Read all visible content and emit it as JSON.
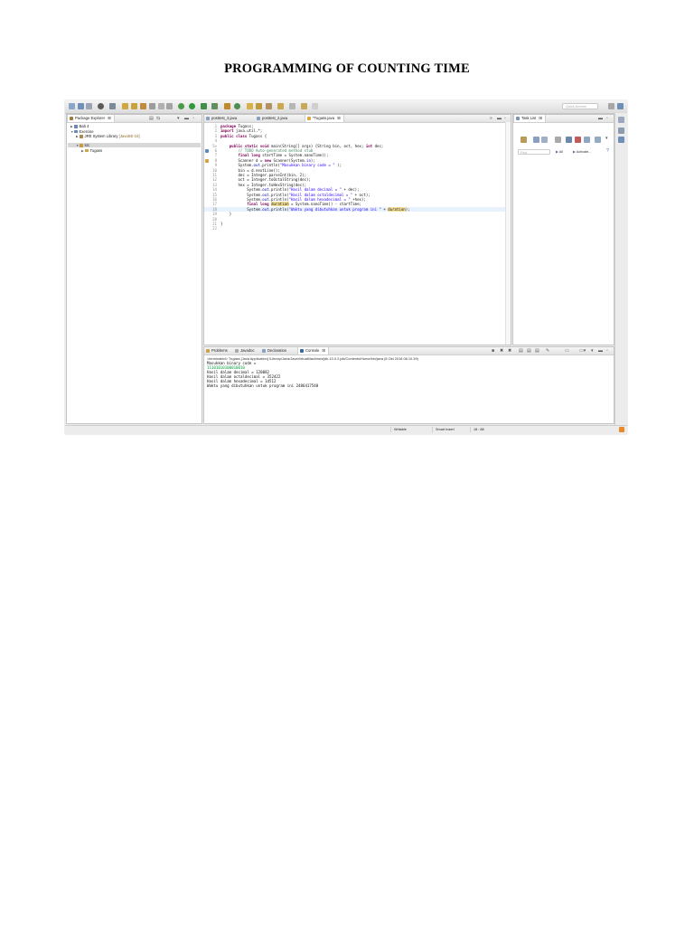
{
  "document": {
    "title": "PROGRAMMING OF COUNTING TIME"
  },
  "toolbar": {
    "quick_access_placeholder": "Quick Access"
  },
  "package_explorer": {
    "title": "Package Explorer",
    "close_glyph": "☒",
    "items": [
      {
        "label": "Bab 4",
        "suffix": ""
      },
      {
        "label": "Exercise",
        "suffix": ""
      },
      {
        "label": "JRE System Library",
        "suffix": "[JavaSE-10]"
      },
      {
        "label": "src",
        "suffix": ""
      },
      {
        "label": "Tugass",
        "suffix": ""
      }
    ]
  },
  "editor": {
    "tabs": [
      {
        "label": "posttest_3.java"
      },
      {
        "label": "posttest_2.java"
      },
      {
        "label": "*Tugass.java"
      }
    ],
    "line_numbers": [
      "1",
      "2",
      "3",
      "4",
      "5⊖",
      "6",
      "7",
      "8",
      "9",
      "10",
      "11",
      "12",
      "13",
      "14",
      "15",
      "16",
      "17",
      "18",
      "19",
      "20",
      "21",
      "22"
    ],
    "lines": [
      "package Tugass;",
      "import java.util.*;",
      "public class Tugass {",
      "",
      "    public static void main(String[] args) {String bin, oct, hex; int dec;",
      "        // TODO Auto-generated method stub",
      "        final long startTime = System.nanoTime();",
      "        Scanner d = new Scanner(System.in);",
      "        System.out.println(\"Masukkan binary code = \" );",
      "        bin = d.nextLine();",
      "        dec = Integer.parseInt(bin, 2);",
      "        oct = Integer.toOctalString(dec);",
      "        hex = Integer.toHexString(dec);",
      "            System.out.println(\"Hasil dalam decimal = \" + dec);",
      "            System.out.println(\"Hasil dalam octaldecimal = \" + oct);",
      "            System.out.println(\"Hasil dalam hexadecimal = \" +hex);",
      "            final long duration = System.nanoTime() - startTime;",
      "            System.out.println(\"Waktu yang dibutuhkan untuk program ini \" + duration);",
      "    }",
      "",
      "}",
      ""
    ]
  },
  "task_list": {
    "title": "Task List",
    "filter_placeholder": "Find",
    "all_label": "All",
    "activate_label": "Activate..."
  },
  "bottom_panel": {
    "tabs": [
      {
        "label": "Problems"
      },
      {
        "label": "Javadoc"
      },
      {
        "label": "Declaration"
      },
      {
        "label": "Console"
      }
    ],
    "console_header": "<terminated> Tugass [Java Application] /Library/Java/JavaVirtualMachines/jdk-10.0.2.jdk/Contents/Home/bin/java (8 Okt 2018 08.10.39)",
    "console_lines": [
      {
        "text": "Masukkan binary code = ",
        "kind": "out"
      },
      {
        "text": "11101010100010010",
        "kind": "input"
      },
      {
        "text": "Hasil dalam decimal = 120082",
        "kind": "out"
      },
      {
        "text": "Hasil dalam octaldecimal = 352422",
        "kind": "out"
      },
      {
        "text": "Hasil dalam hexadecimal = 1d512",
        "kind": "out"
      },
      {
        "text": "Waktu yang dibutuhkan untuk program ini 2486417540",
        "kind": "out"
      }
    ]
  },
  "statusbar": {
    "writable": "Writable",
    "insert_mode": "Smart Insert",
    "position": "18 : 88"
  },
  "colors": {
    "keyword": "#7f0055",
    "string": "#2a00ff",
    "comment": "#3f7f5f",
    "console_input": "#009b3a",
    "current_line": "#e8f2fe",
    "selection": "#d8d8d8"
  }
}
